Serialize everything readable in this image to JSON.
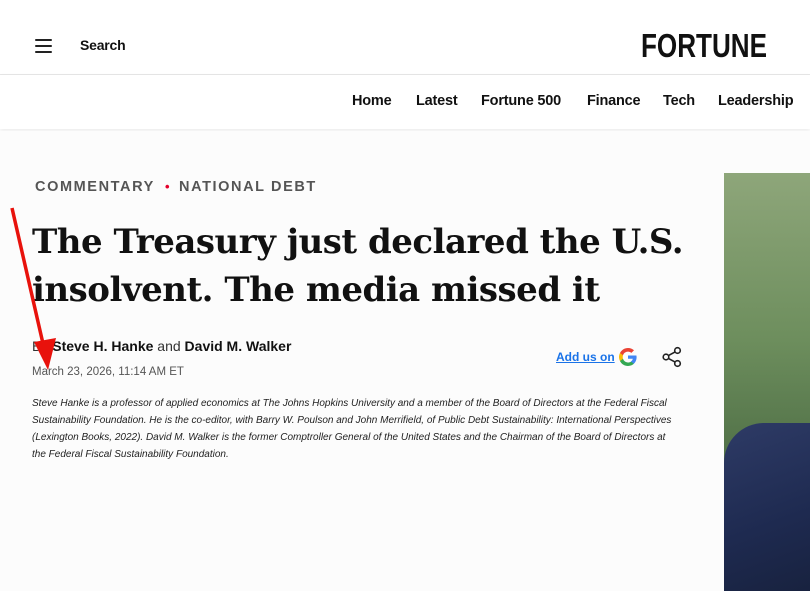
{
  "header": {
    "search_label": "Search",
    "logo_text": "FORTUNE"
  },
  "nav": {
    "items": [
      "Home",
      "Latest",
      "Fortune 500",
      "Finance",
      "Tech",
      "Leadership"
    ]
  },
  "article": {
    "breadcrumb": [
      "COMMENTARY",
      "NATIONAL DEBT"
    ],
    "headline": "The Treasury just declared the U.S. insolvent. The media missed it",
    "byline_prefix": "By",
    "author_1": "Steve H. Hanke",
    "byline_and": "and",
    "author_2": "David M. Walker",
    "date": "March 23, 2026, 11:14 AM ET",
    "bio": "Steve Hanke is a professor of applied economics at The Johns Hopkins University and a member of the Board of Directors at the Federal Fiscal Sustainability Foundation. He is the co-editor, with Barry W. Poulson and John Merrifield, of Public Debt Sustainability: International Perspectives (Lexington Books, 2022). David M. Walker is the former Comptroller General of the United States and the Chairman of the Board of Directors at the Federal Fiscal Sustainability Foundation."
  },
  "actions": {
    "add_us_label": "Add us on",
    "google_icon": "google-icon",
    "share_icon": "share-icon"
  },
  "colors": {
    "accent_red": "#e4002b",
    "link_blue": "#1a73e8",
    "annotation_arrow": "#e8120c"
  }
}
